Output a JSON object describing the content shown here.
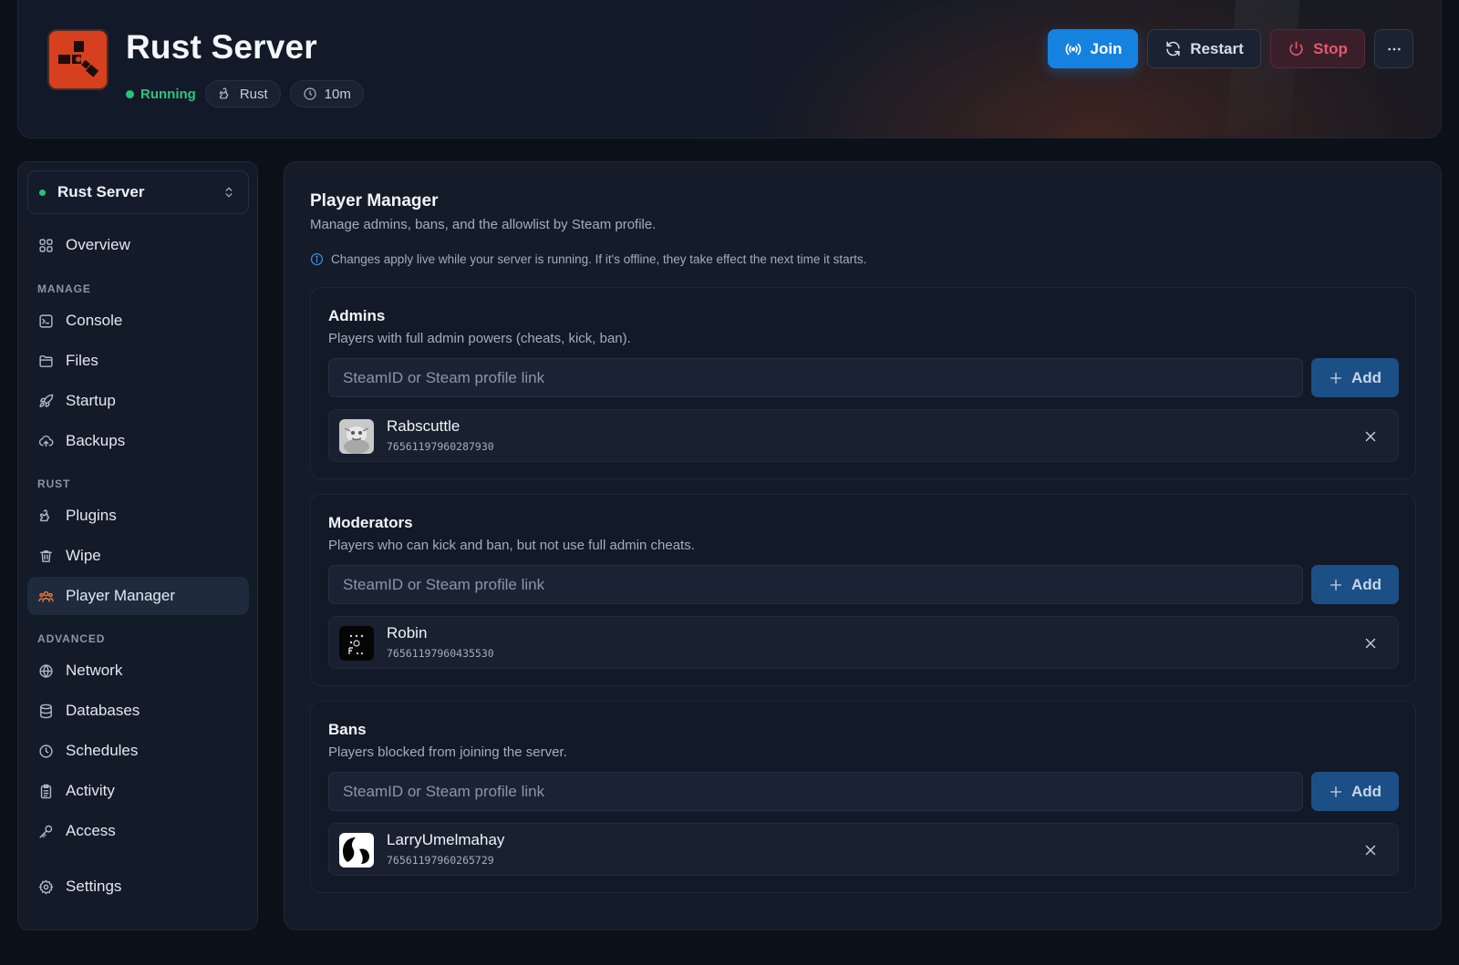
{
  "header": {
    "title": "Rust Server",
    "status": "Running",
    "game_tag": "Rust",
    "uptime": "10m",
    "buttons": {
      "join": "Join",
      "restart": "Restart",
      "stop": "Stop"
    }
  },
  "sidebar": {
    "server_name": "Rust Server",
    "overview": "Overview",
    "sections": {
      "manage": "MANAGE",
      "rust": "RUST",
      "advanced": "ADVANCED"
    },
    "items": {
      "console": "Console",
      "files": "Files",
      "startup": "Startup",
      "backups": "Backups",
      "plugins": "Plugins",
      "wipe": "Wipe",
      "player_manager": "Player Manager",
      "network": "Network",
      "databases": "Databases",
      "schedules": "Schedules",
      "activity": "Activity",
      "access": "Access",
      "settings": "Settings"
    },
    "active": "player_manager"
  },
  "main": {
    "title": "Player Manager",
    "subtitle": "Manage admins, bans, and the allowlist by Steam profile.",
    "info": "Changes apply live while your server is running. If it's offline, they take effect the next time it starts.",
    "input_placeholder": "SteamID or Steam profile link",
    "add_label": "Add",
    "cards": [
      {
        "title": "Admins",
        "subtitle": "Players with full admin powers (cheats, kick, ban).",
        "player": {
          "name": "Rabscuttle",
          "steam_id": "76561197960287930"
        }
      },
      {
        "title": "Moderators",
        "subtitle": "Players who can kick and ban, but not use full admin cheats.",
        "player": {
          "name": "Robin",
          "steam_id": "76561197960435530"
        }
      },
      {
        "title": "Bans",
        "subtitle": "Players blocked from joining the server.",
        "player": {
          "name": "LarryUmelmahay",
          "steam_id": "76561197960265729"
        }
      }
    ]
  },
  "colors": {
    "accent_blue": "#1682e0",
    "running_green": "#25c47a",
    "stop_red": "#e25a6e",
    "active_icon_orange": "#ef7a43",
    "rust_logo": "#d6401e"
  }
}
